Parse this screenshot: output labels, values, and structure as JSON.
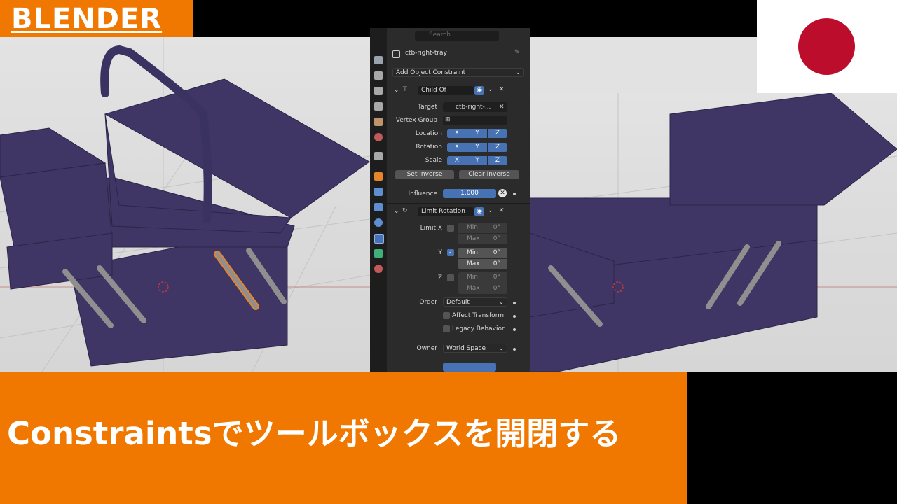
{
  "badge": {
    "text": "BLENDER"
  },
  "banner": {
    "text": "Constraintsでツールボックスを開閉する"
  },
  "panel": {
    "search_placeholder": "Search",
    "object_name": "ctb-right-tray",
    "add_constraint": "Add Object Constraint",
    "child_of": {
      "name": "Child Of",
      "target_label": "Target",
      "target_value": "ctb-right-...",
      "vertex_group_label": "Vertex Group",
      "location_label": "Location",
      "rotation_label": "Rotation",
      "scale_label": "Scale",
      "axes": [
        "X",
        "Y",
        "Z"
      ],
      "set_inverse": "Set Inverse",
      "clear_inverse": "Clear Inverse",
      "influence_label": "Influence",
      "influence_value": "1.000"
    },
    "limit_rotation": {
      "name": "Limit Rotation",
      "limit_x": "Limit X",
      "y": "Y",
      "z": "Z",
      "min": "Min",
      "max": "Max",
      "deg": "0°",
      "order_label": "Order",
      "order_value": "Default",
      "affect_transform": "Affect Transform",
      "legacy_behavior": "Legacy Behavior",
      "owner_label": "Owner",
      "owner_value": "World Space"
    }
  },
  "colors": {
    "orange": "#f07800",
    "flag_red": "#bc0d2c",
    "blender_blue": "#4772b3",
    "toolbox_purple": "#3f3665"
  },
  "icons": [
    "object-icon",
    "pin-icon",
    "constraint-icon",
    "eye-icon",
    "close-icon",
    "vertex-group-icon",
    "chevron-down-icon"
  ]
}
